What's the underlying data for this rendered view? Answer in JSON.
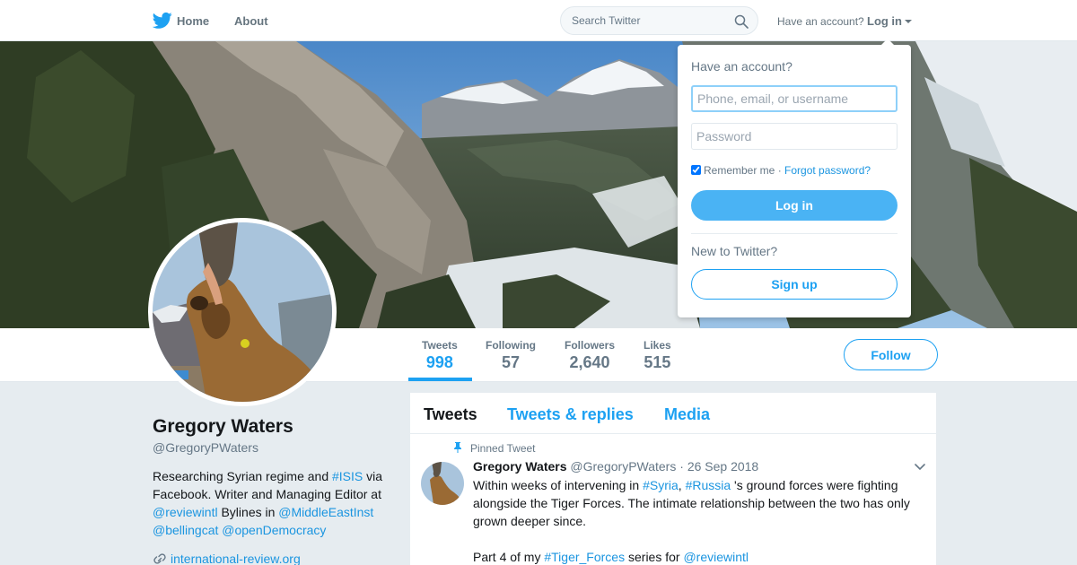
{
  "topnav": {
    "logo": "twitter-bird-icon",
    "home_label": "Home",
    "about_label": "About",
    "search_placeholder": "Search Twitter",
    "have_account_text": "Have an account?",
    "login_label": "Log in"
  },
  "banner": {
    "image": "mountain-valley-photo"
  },
  "profile": {
    "name": "Gregory Waters",
    "handle": "@GregoryPWaters",
    "bio": {
      "t1": "Researching Syrian regime and ",
      "l1": "#ISIS",
      "t2": " via Facebook. Writer and Managing Editor at ",
      "l2": "@reviewintl",
      "t3": " Bylines in ",
      "l3": "@MiddleEastInst",
      "t4": " ",
      "l4": "@bellingcat",
      "t5": " ",
      "l5": "@openDemocracy"
    },
    "website": "international-review.org"
  },
  "stats": [
    {
      "label": "Tweets",
      "value": "998"
    },
    {
      "label": "Following",
      "value": "57"
    },
    {
      "label": "Followers",
      "value": "2,640"
    },
    {
      "label": "Likes",
      "value": "515"
    }
  ],
  "follow_label": "Follow",
  "tabs": [
    {
      "label": "Tweets"
    },
    {
      "label": "Tweets & replies"
    },
    {
      "label": "Media"
    }
  ],
  "pinned_tweet": {
    "pinned_label": "Pinned Tweet",
    "name": "Gregory Waters",
    "handle": "@GregoryPWaters",
    "date": "26 Sep 2018",
    "sep": "·",
    "body": {
      "t1": "Within weeks of intervening in ",
      "l1": "#Syria",
      "t2": ", ",
      "l2": "#Russia",
      "t3": " 's ground forces were fighting alongside the Tiger Forces. The intimate relationship between the two has only grown deeper since.",
      "t4": "Part 4 of my ",
      "l3": "#Tiger_Forces",
      "t5": " series for ",
      "l4": "@reviewintl"
    }
  },
  "login_dropdown": {
    "title": "Have an account?",
    "username_placeholder": "Phone, email, or username",
    "password_placeholder": "Password",
    "remember_label": "Remember me",
    "dot": " · ",
    "forgot_label": "Forgot password?",
    "login_button": "Log in",
    "new_label": "New to Twitter?",
    "signup_button": "Sign up"
  },
  "colors": {
    "accent": "#1da1f2",
    "link": "#1b95e0",
    "background": "#e6ecf0",
    "text_secondary": "#657786"
  }
}
